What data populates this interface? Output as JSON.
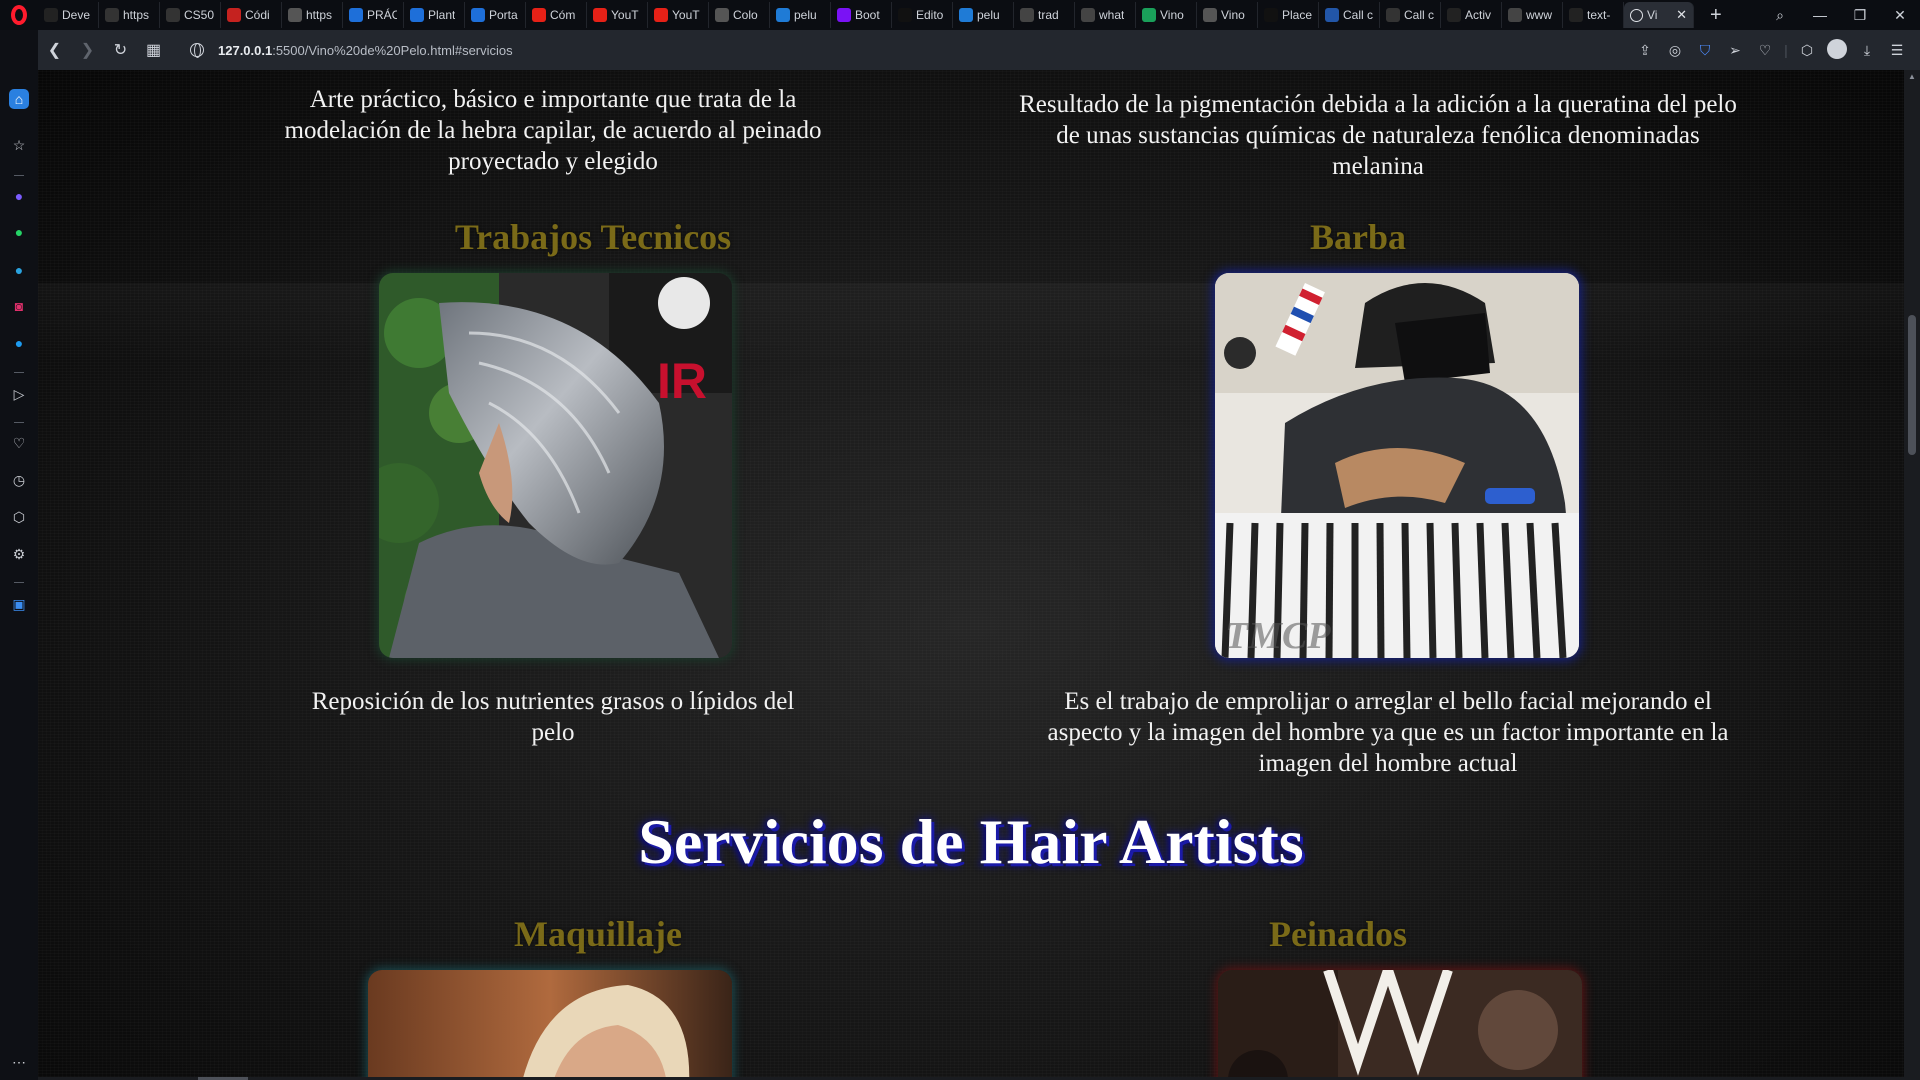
{
  "browser": {
    "tabs": [
      {
        "label": "Deve",
        "icon": "dev-icon",
        "color": "#222222"
      },
      {
        "label": "https",
        "icon": "a-icon",
        "color": "#333333"
      },
      {
        "label": "CS50",
        "icon": "x-icon",
        "color": "#333333"
      },
      {
        "label": "Códi",
        "icon": "gmail-icon",
        "color": "#c5221f"
      },
      {
        "label": "https",
        "icon": "globe-icon",
        "color": "#555555"
      },
      {
        "label": "PRÁC",
        "icon": "doc-icon",
        "color": "#1e6fd9"
      },
      {
        "label": "Plant",
        "icon": "doc-icon",
        "color": "#1e6fd9"
      },
      {
        "label": "Porta",
        "icon": "doc-icon",
        "color": "#1e6fd9"
      },
      {
        "label": "Cóm",
        "icon": "youtube-icon",
        "color": "#e62117"
      },
      {
        "label": "YouT",
        "icon": "youtube-icon",
        "color": "#e62117"
      },
      {
        "label": "YouT",
        "icon": "opera-icon",
        "color": "#e62117"
      },
      {
        "label": "Colo",
        "icon": "globe-icon",
        "color": "#555555"
      },
      {
        "label": "pelu",
        "icon": "trello-icon",
        "color": "#1f7bd6"
      },
      {
        "label": "Boot",
        "icon": "bootstrap-icon",
        "color": "#7a12f5"
      },
      {
        "label": "Edito",
        "icon": "wix-icon",
        "color": "#111111"
      },
      {
        "label": "pelu",
        "icon": "trello-icon",
        "color": "#1f7bd6"
      },
      {
        "label": "trad",
        "icon": "google-icon",
        "color": "#444444"
      },
      {
        "label": "what",
        "icon": "google-icon",
        "color": "#444444"
      },
      {
        "label": "Vino",
        "icon": "maps-icon",
        "color": "#1aa05a"
      },
      {
        "label": "Vino",
        "icon": "globe-icon",
        "color": "#555555"
      },
      {
        "label": "Place",
        "icon": "p-icon",
        "color": "#111111"
      },
      {
        "label": "Call c",
        "icon": "tyc-icon",
        "color": "#2256a8"
      },
      {
        "label": "Call c",
        "icon": "mkm-icon",
        "color": "#333333"
      },
      {
        "label": "Activ",
        "icon": "a-icon",
        "color": "#222222"
      },
      {
        "label": "www",
        "icon": "google-icon",
        "color": "#444444"
      },
      {
        "label": "text-",
        "icon": "m-icon",
        "color": "#222222"
      }
    ],
    "active_tab": {
      "label": "Vi",
      "close": "✕"
    },
    "new_tab": "+",
    "url_host": "127.0.0.1",
    "url_path": ":5500/Vino%20de%20Pelo.html#servicios"
  },
  "content": {
    "intro_left": "Arte práctico, básico e importante que trata de la modelación de la hebra capilar, de acuerdo al peinado proyectado y elegido",
    "intro_right": "Resultado de la pigmentación debida a la adición a la queratina del pelo de unas sustancias químicas de naturaleza fenólica denominadas melanina",
    "card1_title": "Trabajos Tecnicos",
    "card1_desc": "Reposición de los nutrientes grasos o lípidos del pelo",
    "card2_title": "Barba",
    "card2_desc": "Es el trabajo de emprolijar o arreglar el bello facial mejorando el aspecto y la imagen del hombre ya que es un factor importante en la imagen del hombre actual",
    "section_title": "Servicios de Hair Artists",
    "card3_title": "Maquillaje",
    "card4_title": "Peinados",
    "watermark": "TMCP",
    "logo_letters": "IR"
  },
  "colors": {
    "card_title": "#7a6a18",
    "section_title_shadow": "#1b1aa8",
    "background": "#151515"
  }
}
